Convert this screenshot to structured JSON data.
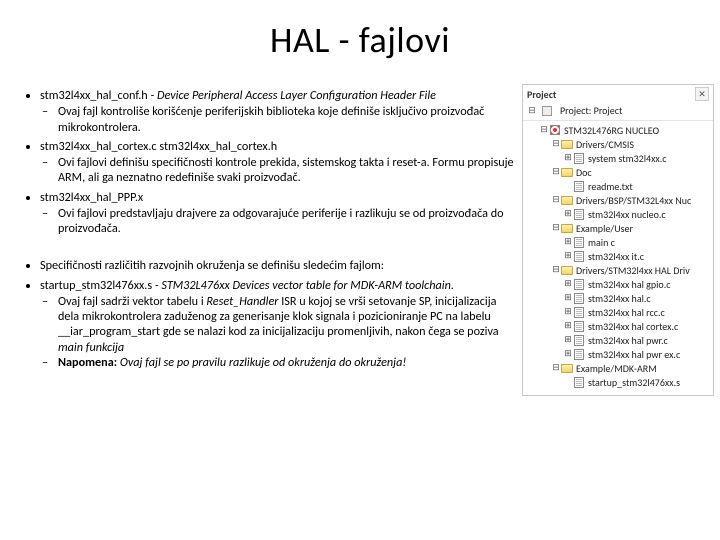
{
  "title": "HAL - fajlovi",
  "bullets": {
    "b1_file": "stm32l4xx_hal_conf.h",
    "b1_desc": " - Device Peripheral Access Layer Configuration Header File",
    "b1_sub": "Ovaj fajl kontroliše korišćenje periferijskih biblioteka koje definiše isključivo proizvođač mikrokontrolera.",
    "b2_file": "stm32l4xx_hal_cortex.c stm32l4xx_hal_cortex.h",
    "b2_sub": "Ovi fajlovi definišu specifičnosti kontrole prekida, sistemskog takta i reset-a. Formu propisuje ARM, ali ga neznatno redefiniše svaki proizvođač.",
    "b3_file": "stm32l4xx_hal_PPP.x",
    "b3_sub": "Ovi fajlovi predstavljaju drajvere za odgovarajuće periferije i razlikuju se od proizvođača do proizvođača.",
    "b4": "Specifičnosti različitih razvojnih okruženja se definišu sledećim fajlom:",
    "b5_file": "startup_stm32l476xx.s",
    "b5_desc": " - STM32L476xx Devices vector table for MDK-ARM toolchain.",
    "b5_sub1_pre": "Ovaj fajl sadrži vektor tabelu i ",
    "b5_sub1_rh": "Reset_Handler",
    "b5_sub1_mid": " ISR u kojoj se vrši setovanje SP, inicijalizacija dela mikrokontrolera zaduženog za generisanje klok signala i pozicioniranje PC na labelu __iar_program_start gde se nalazi kod za inicijalizaciju promenljivih, nakon čega se poziva ",
    "b5_sub1_main": "main funkcija",
    "b5_sub2_lead": "Napomena: ",
    "b5_sub2_txt": "Ovaj fajl se po pravilu razlikuje od okruženja do okruženja!"
  },
  "panel": {
    "tab_active": "Project",
    "tab_inactive": "",
    "close": "✕",
    "root": "Project: Project",
    "target_icon": "target-icon",
    "tree": [
      {
        "d": 1,
        "exp": "⊟",
        "ic": "target",
        "t": "STM32L476RG NUCLEO"
      },
      {
        "d": 2,
        "exp": "⊟",
        "ic": "folder",
        "t": "Drivers/CMSIS"
      },
      {
        "d": 3,
        "exp": "⊞",
        "ic": "file",
        "t": "system stm32l4xx.c"
      },
      {
        "d": 2,
        "exp": "⊟",
        "ic": "folder",
        "t": "Doc"
      },
      {
        "d": 3,
        "exp": "",
        "ic": "file",
        "t": "readme.txt"
      },
      {
        "d": 2,
        "exp": "⊟",
        "ic": "folder",
        "t": "Drivers/BSP/STM32L4xx Nuc"
      },
      {
        "d": 3,
        "exp": "⊞",
        "ic": "file",
        "t": "stm32l4xx nucleo.c"
      },
      {
        "d": 2,
        "exp": "⊟",
        "ic": "folder",
        "t": "Example/User"
      },
      {
        "d": 3,
        "exp": "⊞",
        "ic": "file",
        "t": "main c"
      },
      {
        "d": 3,
        "exp": "⊞",
        "ic": "file",
        "t": "stm32l4xx it.c"
      },
      {
        "d": 2,
        "exp": "⊟",
        "ic": "folder",
        "t": "Drivers/STM32l4xx HAL Driv"
      },
      {
        "d": 3,
        "exp": "⊞",
        "ic": "file",
        "t": "stm32l4xx hal gpio.c"
      },
      {
        "d": 3,
        "exp": "⊞",
        "ic": "file",
        "t": "stm32l4xx hal.c"
      },
      {
        "d": 3,
        "exp": "⊞",
        "ic": "file",
        "t": "stm32l4xx hal rcc.c"
      },
      {
        "d": 3,
        "exp": "⊞",
        "ic": "file",
        "t": "stm32l4xx hal cortex.c"
      },
      {
        "d": 3,
        "exp": "⊞",
        "ic": "file",
        "t": "stm32l4xx hal pwr.c"
      },
      {
        "d": 3,
        "exp": "⊞",
        "ic": "file",
        "t": "stm32l4xx hal pwr ex.c"
      },
      {
        "d": 2,
        "exp": "⊟",
        "ic": "folder",
        "t": "Example/MDK-ARM"
      },
      {
        "d": 3,
        "exp": "",
        "ic": "file",
        "t": "startup_stm32l476xx.s"
      }
    ]
  }
}
